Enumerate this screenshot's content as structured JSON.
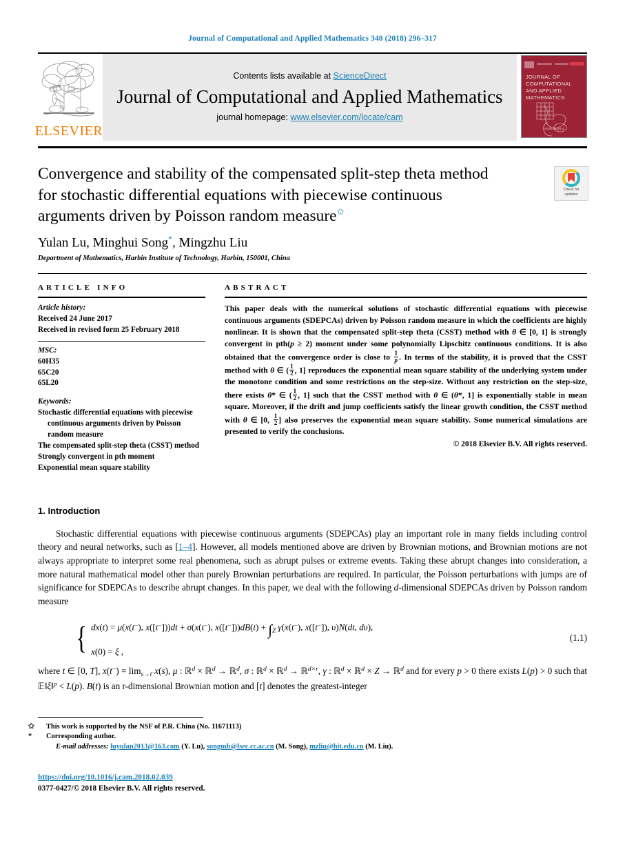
{
  "running_head": "Journal of Computational and Applied Mathematics 340 (2018) 296–317",
  "masthead": {
    "publisher_name": "ELSEVIER",
    "contents_prefix": "Contents lists available at ",
    "contents_link": "ScienceDirect",
    "journal_name": "Journal of Computational and Applied Mathematics",
    "homepage_prefix": "journal homepage: ",
    "homepage_link": "www.elsevier.com/locate/cam",
    "cover_title": "JOURNAL OF COMPUTATIONAL AND APPLIED MATHEMATICS",
    "cover_footer": "ScienceDirect"
  },
  "article": {
    "title": "Convergence and stability of the compensated split-step theta method for stochastic differential equations with piecewise continuous arguments driven by Poisson random measure",
    "title_marker": "✩",
    "authors": "Yulan Lu, Minghui Song",
    "authors_tail": ", Mingzhu Liu",
    "corresponding_marker": "*",
    "affiliation": "Department of Mathematics, Harbin Institute of Technology, Harbin, 150001, China",
    "crossmark_label_line1": "Check for",
    "crossmark_label_line2": "updates"
  },
  "info": {
    "heading": "ARTICLE INFO",
    "history_label": "Article history:",
    "history": [
      "Received 24 June 2017",
      "Received in revised form 25 February 2018"
    ],
    "msc_label": "MSC:",
    "msc": [
      "60H35",
      "65C20",
      "65L20"
    ],
    "keywords_label": "Keywords:",
    "keywords": [
      "Stochastic differential equations with piecewise continuous arguments driven by Poisson random measure",
      "The compensated split-step theta (CSST) method",
      "Strongly convergent in pth moment",
      "Exponential mean square stability"
    ]
  },
  "abstract": {
    "heading": "ABSTRACT",
    "p1": "This paper deals with the numerical solutions of stochastic differential equations with piecewise continuous arguments (SDEPCAs) driven by Poisson random measure in which the coefficients are highly nonlinear. It is shown that the compensated split-step theta (CSST) method with ",
    "p1b": " is strongly convergent in pth(",
    "p1c": " 2) moment under some polynomially Lipschitz continuous conditions. It is also obtained that the convergence order is close to ",
    "p1d": ". In terms of the stability, it is proved that the CSST method with ",
    "p1e": " reproduces the exponential mean square stability of the underlying system under the monotone condition and some restrictions on the step-size. Without any restriction on the step-size, there exists ",
    "p1f": " such that the CSST method with ",
    "p1g": " is exponentially stable in mean square. Moreover, if the drift and jump coefficients satisfy the linear growth condition, the CSST method with ",
    "p1h": " also preserves the exponential mean square stability. Some numerical simulations are presented to verify the conclusions.",
    "copyright": "© 2018 Elsevier B.V. All rights reserved."
  },
  "introduction": {
    "heading": "1. Introduction",
    "paragraph_part1": "Stochastic differential equations with piecewise continuous arguments (SDEPCAs) play an important role in many fields including control theory and neural networks, such as [",
    "reference_link": "1–4",
    "paragraph_part2": "]. However, all models mentioned above are driven by Brownian motions, and Brownian motions are not always appropriate to interpret some real phenomena, such as abrupt pulses or extreme events. Taking these abrupt changes into consideration, a more natural mathematical model other than purely Brownian perturbations are required. In particular, the Poisson perturbations with jumps are of significance for SDEPCAs to describe abrupt changes. In this paper, we deal with the following ",
    "paragraph_part3": "-dimensional SDEPCAs driven by Poisson random measure",
    "equation_number": "(1.1)",
    "equation_line1": "dx(t) = μ(x(t⁻), x([t⁻]))dt + σ(x(t⁻), x([t⁻]))dB(t) +",
    "equation_integral_sub": "Z",
    "equation_line1b": "γ(x(t⁻), x([t⁻]), υ)N(dt, dυ),",
    "equation_line2": "x(0) = ξ ,",
    "after_eq_1": "where t ∈ [0, T], x(t⁻) = lim",
    "after_eq_2": "x(s), μ : ℝᵈ × ℝᵈ → ℝᵈ, σ : ℝᵈ × ℝᵈ → ℝᵈˣʳ, γ : ℝᵈ × ℝᵈ × Z → ℝᵈ and for every p > 0 there exists L(p) > 0 such that 𝔼‖ξ‖ᵖ < L(p). B(t) is an r-dimensional Brownian motion and [t] denotes the greatest-integer"
  },
  "footnotes": {
    "funding_marker": "✩",
    "funding": "This work is supported by the NSF of P.R. China (No. 11671113)",
    "corresponding_marker": "*",
    "corresponding": "Corresponding author.",
    "email_label": "E-mail addresses:",
    "emails": [
      {
        "address": "luyulan2013@163.com",
        "person": "(Y. Lu)"
      },
      {
        "address": "songmh@lsec.cc.ac.cn",
        "person": "(M. Song)"
      },
      {
        "address": "mzliu@hit.edu.cn",
        "person": "(M. Liu)"
      }
    ]
  },
  "doi": {
    "url": "https://doi.org/10.1016/j.cam.2018.02.039",
    "issn_copyright": "0377-0427/© 2018 Elsevier B.V. All rights reserved."
  },
  "colors": {
    "link": "#1a7fb5",
    "elsevier_orange": "#f07c00",
    "cover_red": "#9b2335"
  }
}
